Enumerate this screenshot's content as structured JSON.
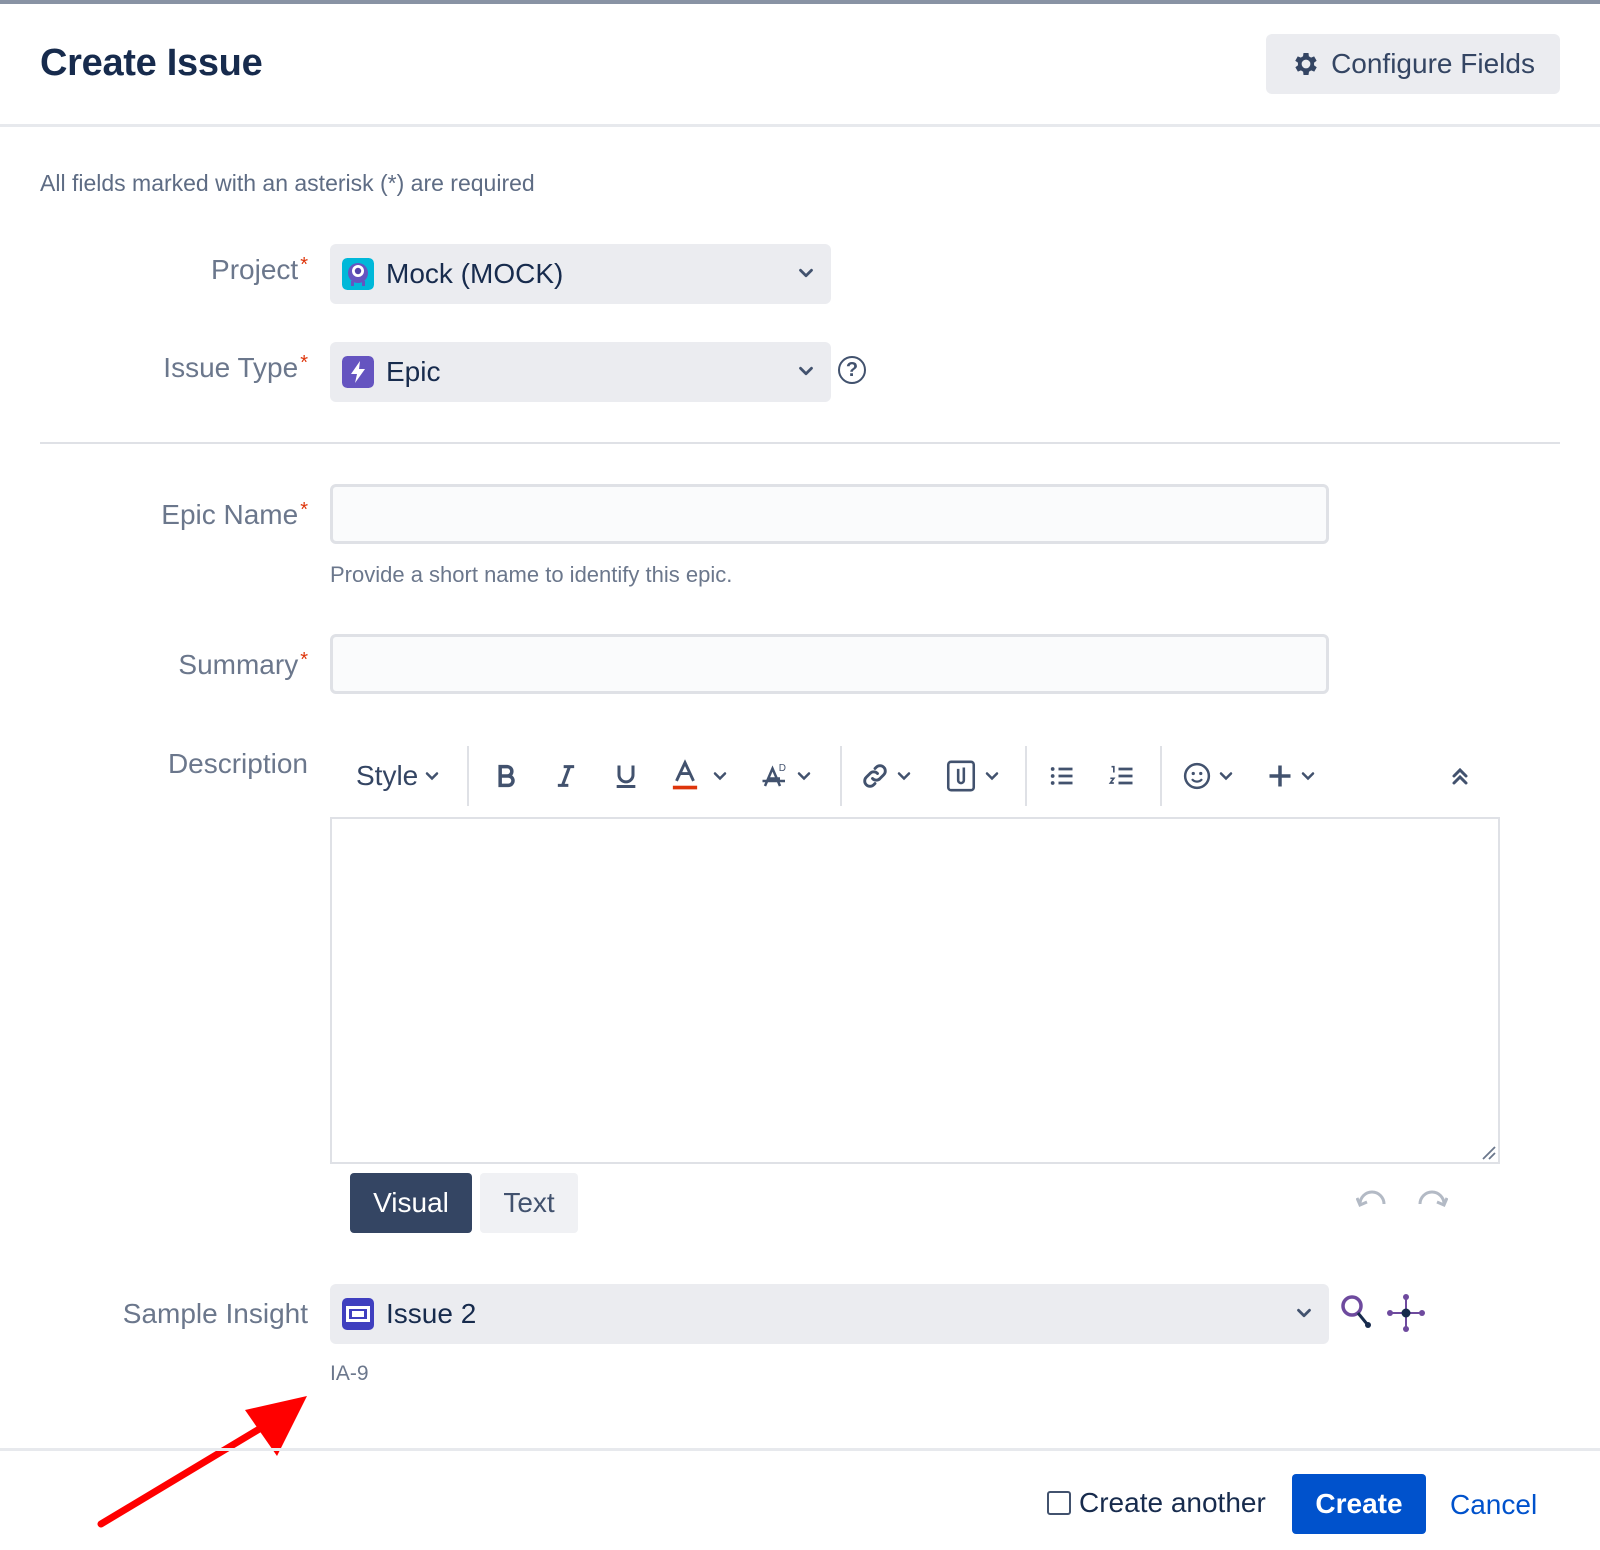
{
  "dialog": {
    "title": "Create Issue",
    "configure_fields_label": "Configure Fields",
    "required_note": "All fields marked with an asterisk (*) are required"
  },
  "fields": {
    "project": {
      "label": "Project",
      "required_mark": "*",
      "value": "Mock (MOCK)",
      "icon": "project-avatar-icon"
    },
    "issue_type": {
      "label": "Issue Type",
      "required_mark": "*",
      "value": "Epic",
      "icon": "epic-icon"
    },
    "epic_name": {
      "label": "Epic Name",
      "required_mark": "*",
      "value": "",
      "hint": "Provide a short name to identify this epic."
    },
    "summary": {
      "label": "Summary",
      "required_mark": "*",
      "value": ""
    },
    "description": {
      "label": "Description",
      "style_label": "Style",
      "mode_visual": "Visual",
      "mode_text": "Text",
      "value": ""
    },
    "sample_insight": {
      "label": "Sample Insight",
      "value": "Issue 2",
      "key": "IA-9",
      "icon": "insight-object-icon"
    }
  },
  "toolbar_icons": [
    "bold-icon",
    "italic-icon",
    "underline-icon",
    "text-color-icon",
    "text-effects-icon",
    "link-icon",
    "attachment-icon",
    "bullet-list-icon",
    "numbered-list-icon",
    "emoji-icon",
    "insert-more-icon",
    "collapse-toolbar-icon"
  ],
  "footer": {
    "create_another_label": "Create another",
    "create_another_checked": false,
    "create_label": "Create",
    "cancel_label": "Cancel"
  },
  "colors": {
    "primary": "#0052cc",
    "required": "#de350b",
    "epic": "#6554c0",
    "annotation_arrow": "#ff0000"
  }
}
